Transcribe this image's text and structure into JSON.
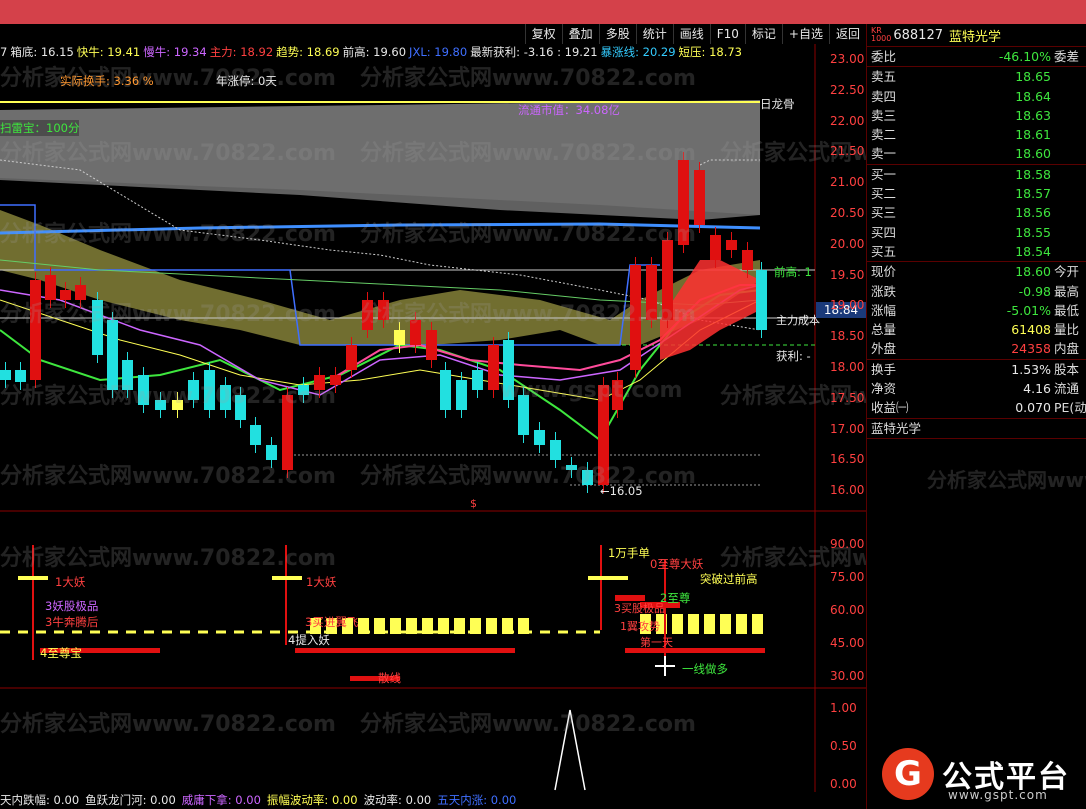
{
  "toolbar": {
    "buttons": [
      "复权",
      "叠加",
      "多股",
      "统计",
      "画线",
      "F10",
      "标记",
      "+自选",
      "返回"
    ]
  },
  "infobar": [
    {
      "text": "7",
      "color": "#e8e8e8"
    },
    {
      "text": "箱底: 16.15",
      "color": "#e8e8e8"
    },
    {
      "text": "快牛: 19.41",
      "color": "#ffff55"
    },
    {
      "text": "慢牛: 19.34",
      "color": "#cc66ff"
    },
    {
      "text": "主力: 18.92",
      "color": "#ff4040"
    },
    {
      "text": "趋势: 18.69",
      "color": "#ffff55"
    },
    {
      "text": "前高: 19.60",
      "color": "#e8e8e8"
    },
    {
      "text": "JXL: 19.80",
      "color": "#3f6fff"
    },
    {
      "text": "最新获利: -3.16 : 19.21",
      "color": "#e8e8e8"
    },
    {
      "text": "暴涨线: 20.29",
      "color": "#33ccff"
    },
    {
      "text": "短压: 18.73",
      "color": "#ffff55"
    }
  ],
  "annotations": {
    "actual_turnover": "实际换手: 3.36 %",
    "year_limit_up": "年涨停: 0天",
    "sweep_score": "扫雷宝：100分",
    "float_cap": "流通市值：34.08亿",
    "dragon_bone": "日龙骨",
    "prev_high_label": "前高: 1",
    "main_cost": "主力成本",
    "profit_label": "获利: -",
    "low_marker": "←16.05",
    "current_price_tag": "18.84",
    "dollar_marker": "$"
  },
  "price_axis": [
    "23.00",
    "22.50",
    "22.00",
    "21.50",
    "21.00",
    "20.50",
    "20.00",
    "19.50",
    "19.00",
    "18.50",
    "18.00",
    "17.50",
    "17.00",
    "16.50",
    "16.00"
  ],
  "indicator_axis": [
    "90.00",
    "75.00",
    "60.00",
    "45.00",
    "30.00"
  ],
  "indicator_labels": {
    "big_demon_1": "1大妖",
    "big_demon_2": "1大妖",
    "demon_select": "3妖股极品",
    "supreme_treasure": "4至尊宝",
    "enter_demon": "4提入妖",
    "dash_line": "散线",
    "ten_thousand": "1万手单",
    "zero_supreme": "0至尊大妖",
    "break_prev_high": "突破过前高",
    "supreme_2": "2至尊",
    "one_line_long": "一线做多",
    "sub_a": "3买家股份",
    "sub_b": "3牛奔腾后",
    "sub_c": "3买进翼飞",
    "sub_d": "3买股极品",
    "sub_e": "1翼攻势",
    "sub_f": "第一天"
  },
  "bottom_axis": [
    "1.00",
    "0.50",
    "0.00"
  ],
  "bottombar": [
    {
      "text": "天内跌幅: 0.00",
      "color": "#e8e8e8"
    },
    {
      "text": "鱼跃龙门河: 0.00",
      "color": "#e8e8e8"
    },
    {
      "text": "威庸下拿: 0.00",
      "color": "#cc66ff"
    },
    {
      "text": "振幅波动率: 0.00",
      "color": "#ffff55"
    },
    {
      "text": "波动率: 0.00",
      "color": "#e8e8e8"
    },
    {
      "text": "五天内涨: 0.00",
      "color": "#3f6fff"
    }
  ],
  "stock": {
    "market_tag": "KR\n1000",
    "code": "688127",
    "name": "蓝特光学",
    "name_footer": "蓝特光学"
  },
  "orderbook": {
    "commission_ratio_label": "委比",
    "commission_ratio": "-46.10%",
    "commission_diff_label": "委差",
    "sells": [
      {
        "label": "卖五",
        "price": "18.65"
      },
      {
        "label": "卖四",
        "price": "18.64"
      },
      {
        "label": "卖三",
        "price": "18.63"
      },
      {
        "label": "卖二",
        "price": "18.61"
      },
      {
        "label": "卖一",
        "price": "18.60"
      }
    ],
    "buys": [
      {
        "label": "买一",
        "price": "18.58"
      },
      {
        "label": "买二",
        "price": "18.57"
      },
      {
        "label": "买三",
        "price": "18.56"
      },
      {
        "label": "买四",
        "price": "18.55"
      },
      {
        "label": "买五",
        "price": "18.54"
      }
    ]
  },
  "quote": [
    {
      "label": "现价",
      "value": "18.60",
      "color": "#3ee63e",
      "right": "今开"
    },
    {
      "label": "涨跌",
      "value": "-0.98",
      "color": "#3ee63e",
      "right": "最高"
    },
    {
      "label": "涨幅",
      "value": "-5.01%",
      "color": "#3ee63e",
      "right": "最低"
    },
    {
      "label": "总量",
      "value": "61408",
      "color": "#ffff55",
      "right": "量比"
    },
    {
      "label": "外盘",
      "value": "24358",
      "color": "#ff4040",
      "right": "内盘"
    }
  ],
  "fundamentals": [
    {
      "label": "换手",
      "value": "1.53%",
      "right": "股本"
    },
    {
      "label": "净资",
      "value": "4.16",
      "right": "流通"
    },
    {
      "label": "收益㈠",
      "value": "0.070",
      "right": "PE(动"
    }
  ],
  "watermarks": [
    "分析家公式网www.70822.com",
    "www.gspt.com"
  ],
  "logo": {
    "icon": "G",
    "text": "公式平台",
    "url": "www.gspt.com"
  }
}
